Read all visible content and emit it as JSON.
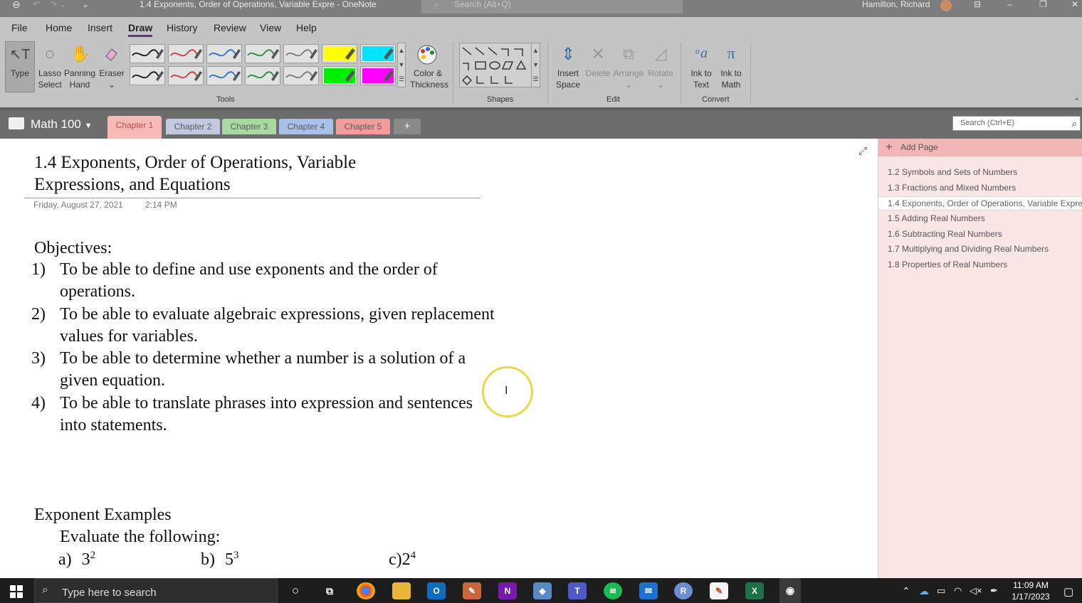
{
  "app": {
    "title": "1.4 Exponents, Order of Operations, Variable Expre  -  OneNote",
    "search_placeholder": "Search (Alt+Q)",
    "user": "Hamilton, Richard"
  },
  "menu": [
    "File",
    "Home",
    "Insert",
    "Draw",
    "History",
    "Review",
    "View",
    "Help"
  ],
  "active_menu": "Draw",
  "ribbon": {
    "tools": [
      {
        "label1": "Type",
        "label2": ""
      },
      {
        "label1": "Lasso",
        "label2": "Select"
      },
      {
        "label1": "Panning",
        "label2": "Hand"
      },
      {
        "label1": "Eraser",
        "label2": ""
      }
    ],
    "pens": [
      {
        "color": "#111111",
        "kind": "pen"
      },
      {
        "color": "#d13438",
        "kind": "pen"
      },
      {
        "color": "#2b6cc4",
        "kind": "pen"
      },
      {
        "color": "#1e8a3a",
        "kind": "pen"
      },
      {
        "color": "#777777",
        "kind": "pen"
      },
      {
        "color": "#ffff00",
        "kind": "highlighter"
      },
      {
        "color": "#00e5ff",
        "kind": "highlighter"
      },
      {
        "color": "#111111",
        "kind": "pen"
      },
      {
        "color": "#d13438",
        "kind": "pen"
      },
      {
        "color": "#2b6cc4",
        "kind": "pen"
      },
      {
        "color": "#1e8a3a",
        "kind": "pen"
      },
      {
        "color": "#777777",
        "kind": "pen"
      },
      {
        "color": "#00ee00",
        "kind": "highlighter"
      },
      {
        "color": "#ff00ff",
        "kind": "highlighter"
      }
    ],
    "color_thickness": {
      "line1": "Color &",
      "line2": "Thickness"
    },
    "edit": [
      {
        "line1": "Insert",
        "line2": "Space"
      },
      {
        "line1": "Delete",
        "line2": ""
      },
      {
        "line1": "Arrange",
        "line2": ""
      },
      {
        "line1": "Rotate",
        "line2": ""
      }
    ],
    "convert": [
      {
        "line1": "Ink to",
        "line2": "Text"
      },
      {
        "line1": "Ink to",
        "line2": "Math"
      }
    ],
    "groups": {
      "tools": "Tools",
      "shapes": "Shapes",
      "edit": "Edit",
      "convert": "Convert"
    }
  },
  "notebook": {
    "name": "Math 100",
    "tabs": [
      {
        "label": "Chapter 1",
        "color": "#f8b9b9"
      },
      {
        "label": "Chapter 2",
        "color": "#c3c9e0"
      },
      {
        "label": "Chapter 3",
        "color": "#a8d9a0"
      },
      {
        "label": "Chapter 4",
        "color": "#a9c0ea"
      },
      {
        "label": "Chapter 5",
        "color": "#f29c9c"
      }
    ],
    "add_tab": "+",
    "search_placeholder": "Search (Ctrl+E)"
  },
  "pages": {
    "add_page": "Add Page",
    "items": [
      "1.2 Symbols and Sets of Numbers",
      "1.3 Fractions and Mixed Numbers",
      "1.4 Exponents, Order of Operations, Variable Expres",
      "1.5 Adding Real Numbers",
      "1.6 Subtracting Real Numbers",
      "1.7 Multiplying and Dividing Real Numbers",
      "1.8 Properties of Real Numbers"
    ],
    "selected_index": 2
  },
  "page": {
    "title_line1": "1.4 Exponents, Order of Operations, Variable",
    "title_line2": "Expressions, and Equations",
    "date": "Friday, August 27, 2021",
    "time": "2:14 PM",
    "objectives_heading": "Objectives:",
    "objectives": [
      {
        "num": "1)",
        "lines": [
          "To be able to define and use exponents and the order of",
          "operations."
        ]
      },
      {
        "num": "2)",
        "lines": [
          "To be able to evaluate algebraic expressions, given replacement",
          "values for variables."
        ]
      },
      {
        "num": "3)",
        "lines": [
          "To be able to determine whether a number is a solution of a",
          "given equation."
        ]
      },
      {
        "num": "4)",
        "lines": [
          "To be able to translate phrases into expression and sentences",
          "into statements."
        ]
      }
    ],
    "examples_heading": "Exponent Examples",
    "examples_intro": "Evaluate the following:",
    "examples": [
      {
        "label": "a)",
        "base": "3",
        "exp": "2"
      },
      {
        "label": "b)",
        "base": "5",
        "exp": "3"
      },
      {
        "label": "c)",
        "base": "2",
        "exp": "4"
      }
    ]
  },
  "taskbar": {
    "search": "Type here to search",
    "time": "11:09 AM",
    "date": "1/17/2023"
  }
}
